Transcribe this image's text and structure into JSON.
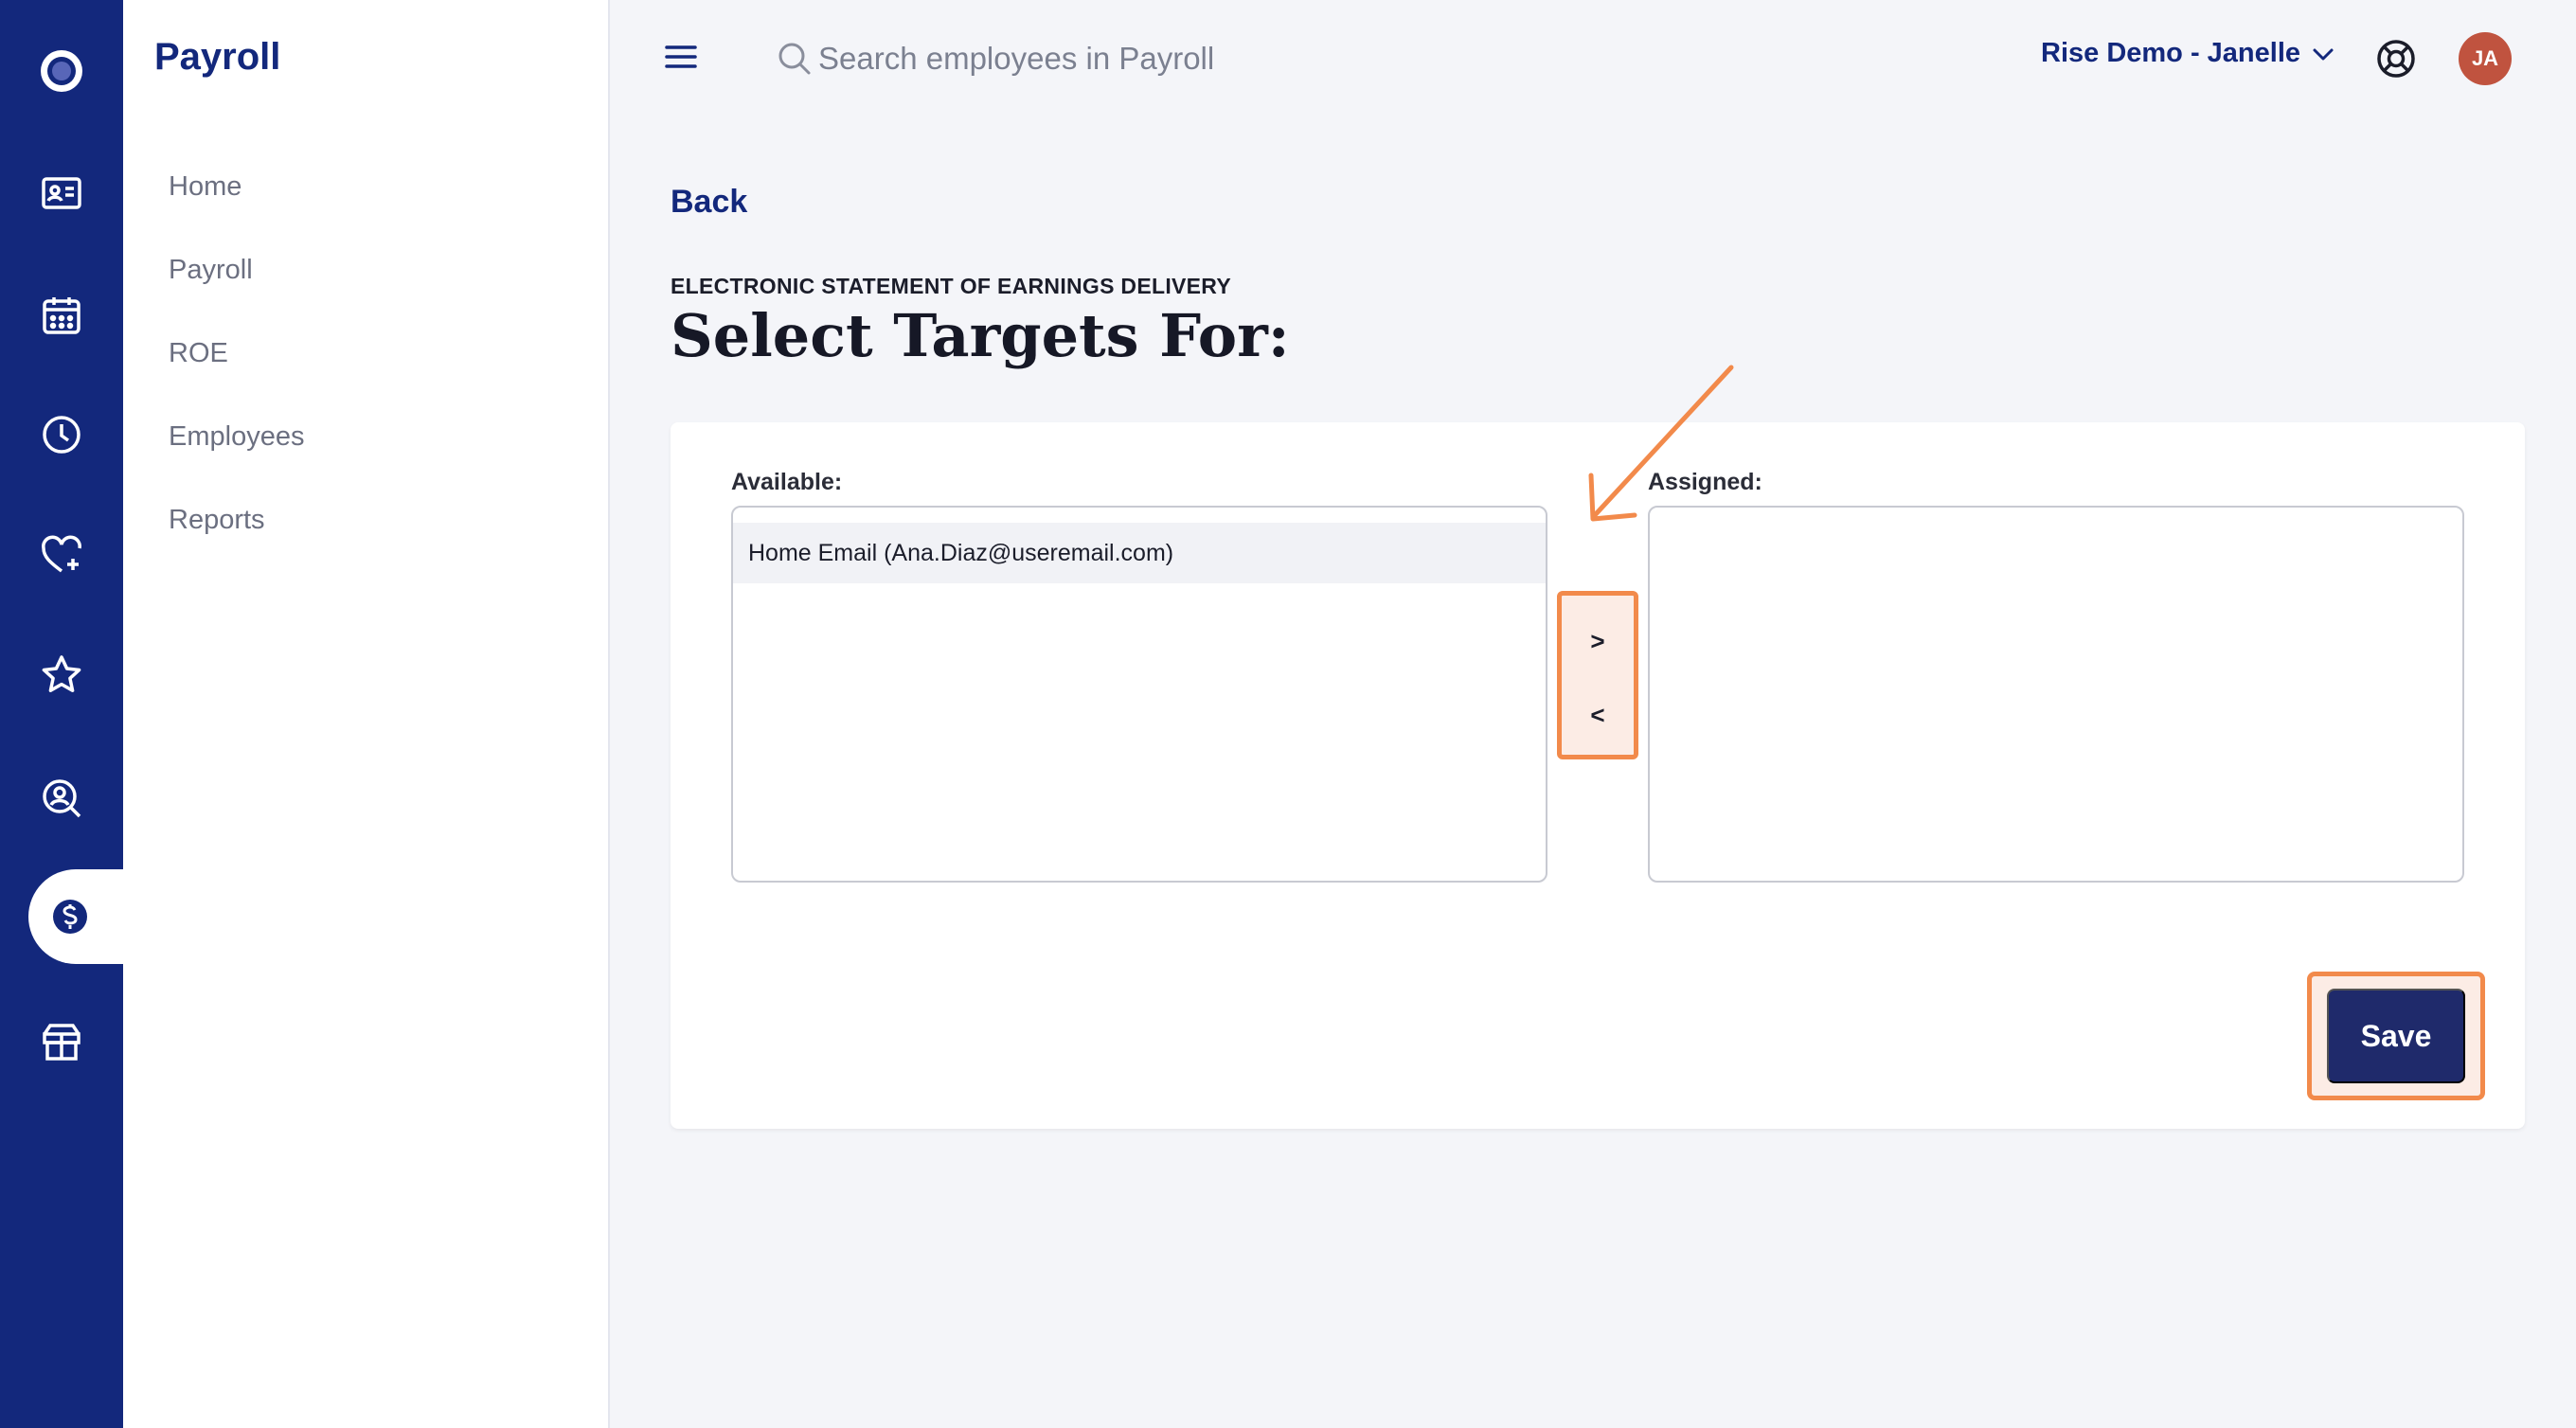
{
  "rail": {
    "items": [
      {
        "icon": "logo-icon"
      },
      {
        "icon": "id-card-icon"
      },
      {
        "icon": "calendar-icon"
      },
      {
        "icon": "clock-icon"
      },
      {
        "icon": "heart-plus-icon"
      },
      {
        "icon": "star-icon"
      },
      {
        "icon": "search-person-icon"
      },
      {
        "icon": "dollar-icon",
        "active": true
      },
      {
        "icon": "gift-box-icon"
      }
    ]
  },
  "sidebar": {
    "title": "Payroll",
    "items": [
      {
        "label": "Home"
      },
      {
        "label": "Payroll"
      },
      {
        "label": "ROE"
      },
      {
        "label": "Employees"
      },
      {
        "label": "Reports"
      }
    ]
  },
  "topbar": {
    "search_placeholder": "Search employees in Payroll",
    "account_label": "Rise Demo - Janelle",
    "avatar_initials": "JA"
  },
  "page": {
    "back_label": "Back",
    "overline": "ELECTRONIC STATEMENT OF EARNINGS DELIVERY",
    "title": "Select Targets For:"
  },
  "targets": {
    "available_label": "Available:",
    "assigned_label": "Assigned:",
    "available_items": [
      "Home Email (Ana.Diaz@useremail.com)"
    ],
    "assigned_items": [],
    "move_right_label": ">",
    "move_left_label": "<",
    "save_label": "Save"
  },
  "colors": {
    "brand": "#13287c",
    "save_button": "#1f2a6b",
    "highlight": "#f28a4b",
    "avatar": "#c0533f"
  }
}
